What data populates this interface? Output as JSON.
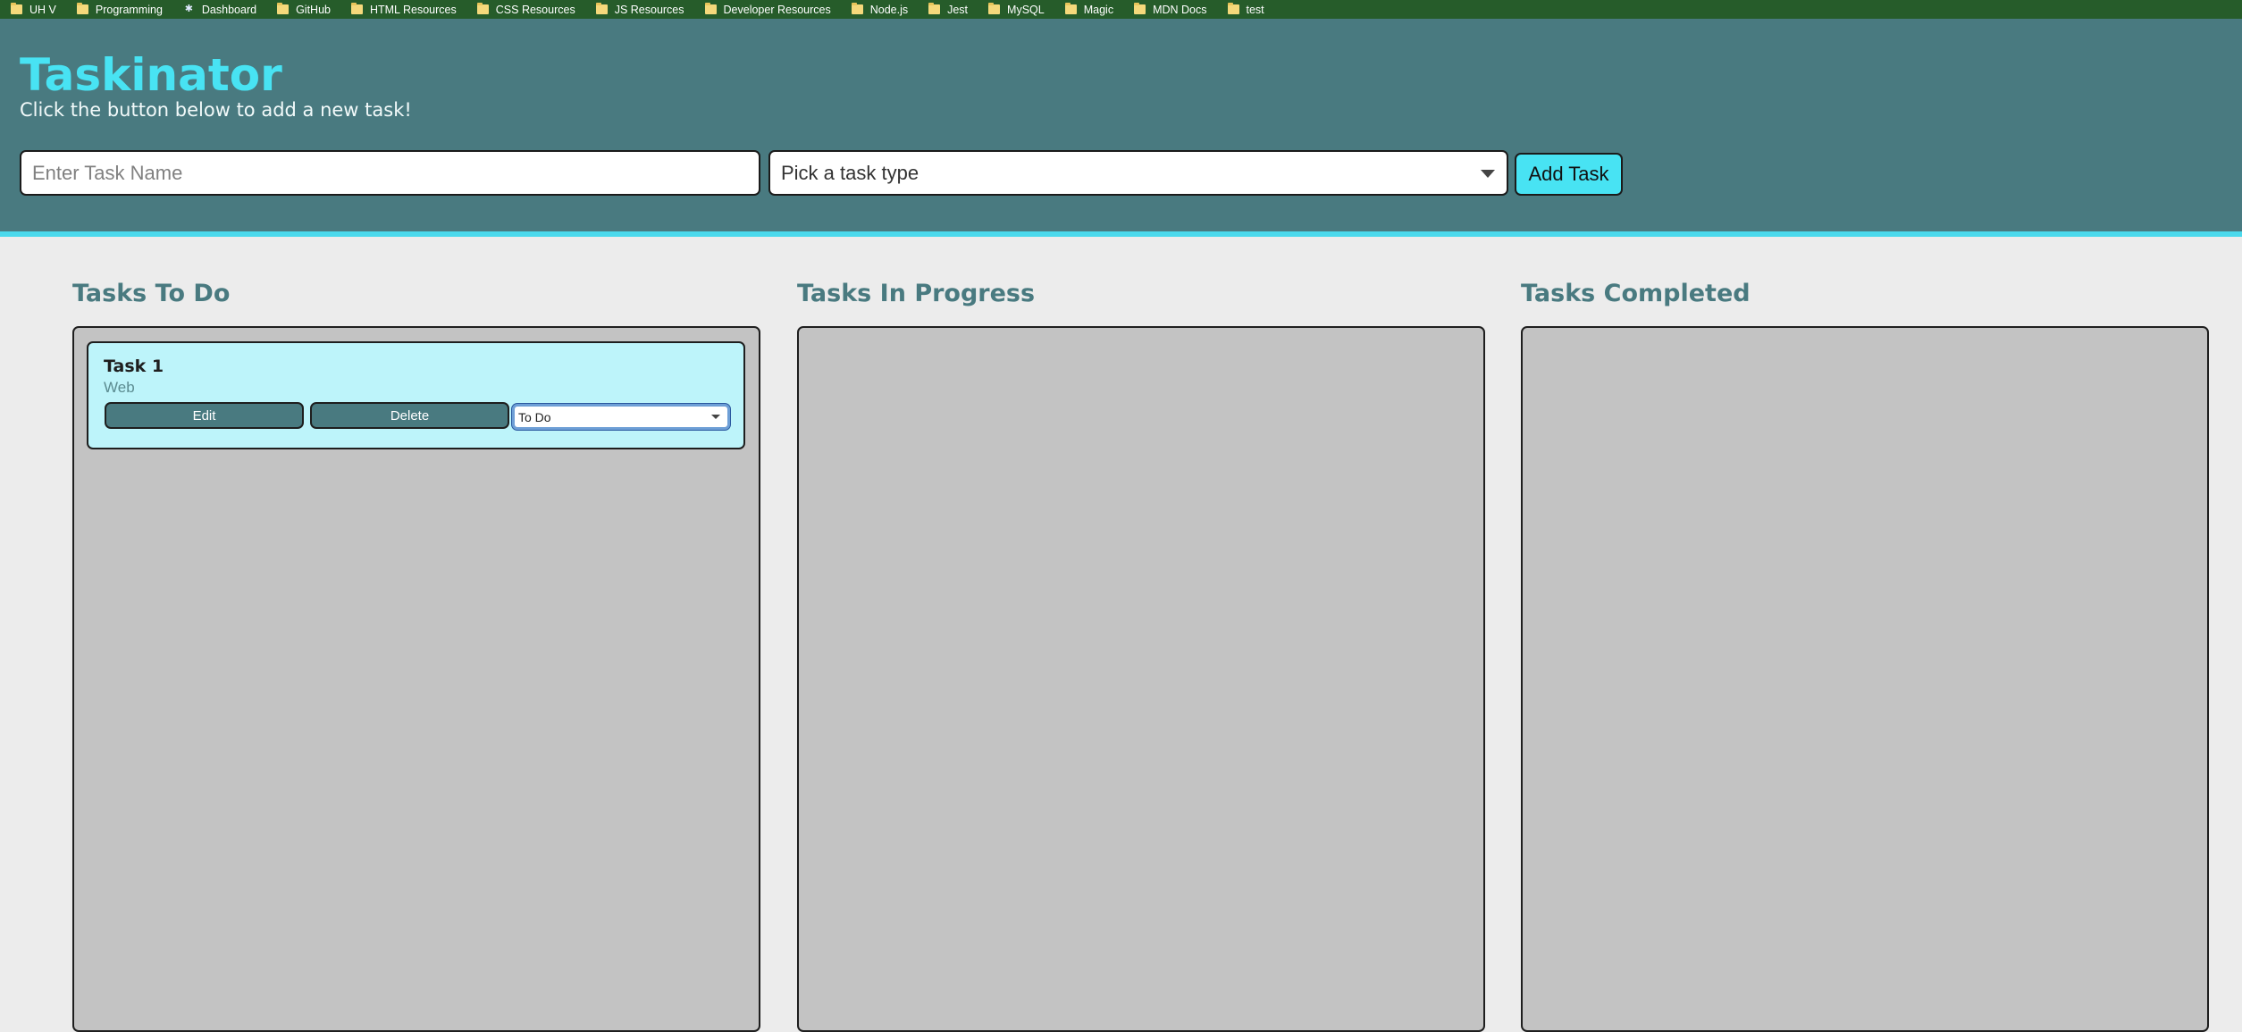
{
  "bookmarks": [
    {
      "label": "UH V",
      "icon": "folder-icon"
    },
    {
      "label": "Programming",
      "icon": "folder-icon"
    },
    {
      "label": "Dashboard",
      "icon": "dashboard-icon"
    },
    {
      "label": "GitHub",
      "icon": "folder-icon"
    },
    {
      "label": "HTML Resources",
      "icon": "folder-icon"
    },
    {
      "label": "CSS Resources",
      "icon": "folder-icon"
    },
    {
      "label": "JS Resources",
      "icon": "folder-icon"
    },
    {
      "label": "Developer Resources",
      "icon": "folder-icon"
    },
    {
      "label": "Node.js",
      "icon": "folder-icon"
    },
    {
      "label": "Jest",
      "icon": "folder-icon"
    },
    {
      "label": "MySQL",
      "icon": "folder-icon"
    },
    {
      "label": "Magic",
      "icon": "folder-icon"
    },
    {
      "label": "MDN Docs",
      "icon": "folder-icon"
    },
    {
      "label": "test",
      "icon": "folder-icon"
    }
  ],
  "header": {
    "title": "Taskinator",
    "subtitle": "Click the button below to add a new task!",
    "task_name_placeholder": "Enter Task Name",
    "task_type_selected": "Pick a task type",
    "add_button_label": "Add Task"
  },
  "columns": [
    {
      "title": "Tasks To Do"
    },
    {
      "title": "Tasks In Progress"
    },
    {
      "title": "Tasks Completed"
    }
  ],
  "tasks": [
    {
      "name": "Task 1",
      "type": "Web",
      "edit_label": "Edit",
      "delete_label": "Delete",
      "status": "To Do"
    }
  ],
  "colors": {
    "bookmark_bar": "#265c2a",
    "header_bg": "#497a80",
    "accent": "#48e3f3",
    "page_bg": "#ececec",
    "column_bg": "#c3c3c3",
    "card_bg": "#bdf4fa"
  }
}
